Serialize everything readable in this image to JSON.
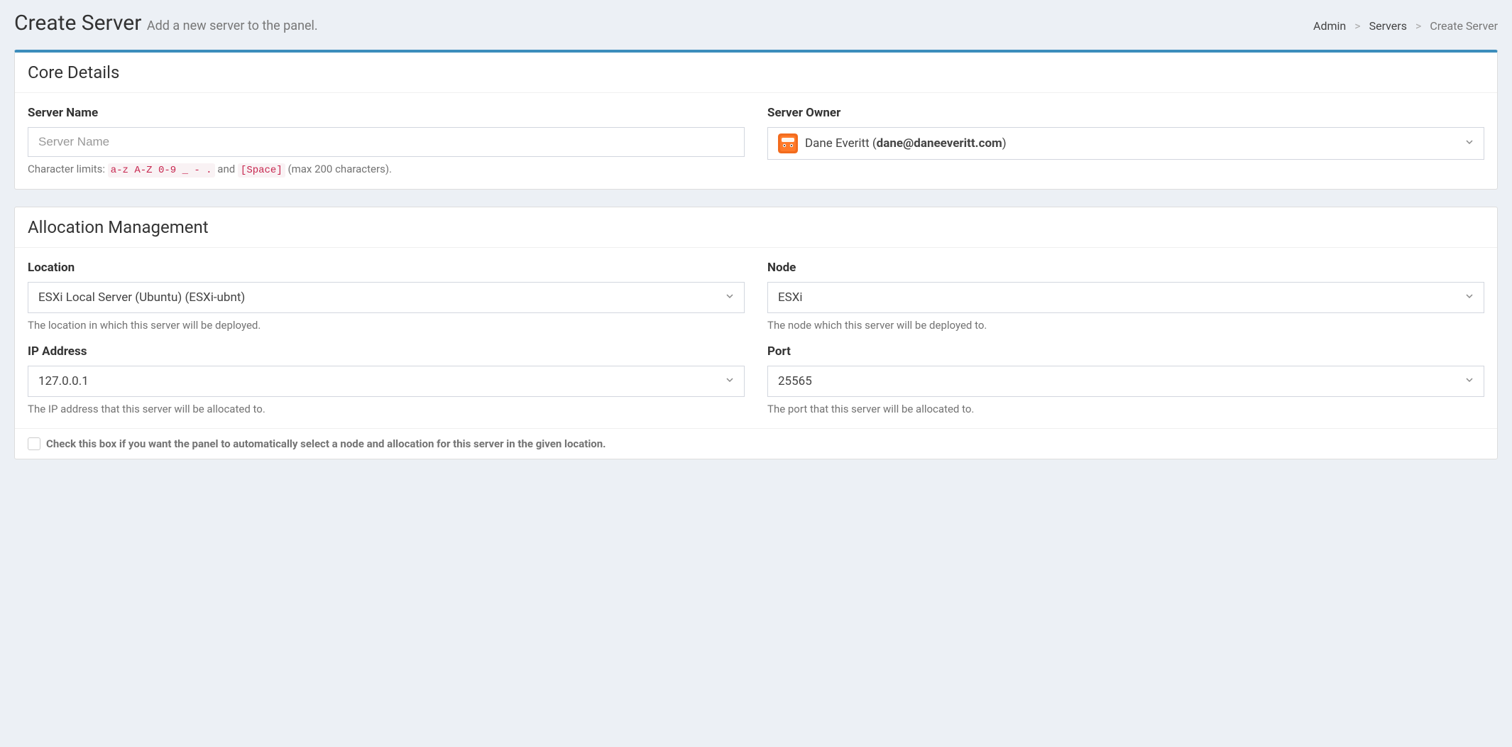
{
  "header": {
    "title": "Create Server",
    "subtitle": "Add a new server to the panel."
  },
  "breadcrumb": {
    "items": [
      "Admin",
      "Servers",
      "Create Server"
    ]
  },
  "core": {
    "title": "Core Details",
    "name_label": "Server Name",
    "name_placeholder": "Server Name",
    "name_help_prefix": "Character limits: ",
    "name_help_code1": "a-z A-Z 0-9 _ - .",
    "name_help_mid": " and ",
    "name_help_code2": "[Space]",
    "name_help_suffix": " (max 200 characters).",
    "owner_label": "Server Owner",
    "owner_name": "Dane Everitt (",
    "owner_email": "dane@daneeveritt.com",
    "owner_close": ")"
  },
  "allocation": {
    "title": "Allocation Management",
    "location_label": "Location",
    "location_value": "ESXi Local Server (Ubuntu) (ESXi-ubnt)",
    "location_help": "The location in which this server will be deployed.",
    "node_label": "Node",
    "node_value": "ESXi",
    "node_help": "The node which this server will be deployed to.",
    "ip_label": "IP Address",
    "ip_value": "127.0.0.1",
    "ip_help": "The IP address that this server will be allocated to.",
    "port_label": "Port",
    "port_value": "25565",
    "port_help": "The port that this server will be allocated to.",
    "auto_label": "Check this box if you want the panel to automatically select a node and allocation for this server in the given location."
  }
}
